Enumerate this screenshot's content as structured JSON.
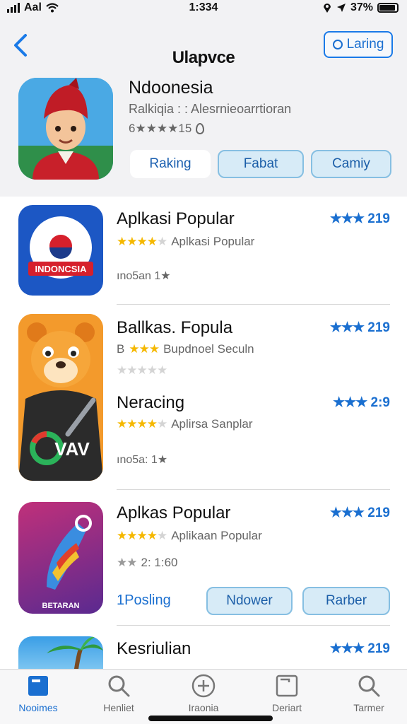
{
  "status": {
    "carrier": "Aal",
    "time": "1:334",
    "battery": "37%"
  },
  "header": {
    "brand": "Ulapvce",
    "lang_button": "Laring",
    "featured": {
      "title": "Ndoonesia",
      "subtitle": "Ralkiqia : : Alesrnieoarrtioran",
      "rating": "6★★★★15"
    },
    "pills": [
      "Raking",
      "Fabat",
      "Camiy"
    ]
  },
  "apps": [
    {
      "name": "Aplkasi Popular",
      "stars": 4,
      "subtitle": "Aplkasi Popular",
      "meta": "ıno5an 1★",
      "score": "219",
      "icon_text": "INDONCSIA"
    },
    {
      "name": "Ballkas. Fopula",
      "stars": 3,
      "subtitle_prefix": "B",
      "subtitle": "Bupdnoel Seculn",
      "score": "219"
    },
    {
      "name": "Neracing",
      "stars": 4,
      "subtitle": "Aplirsa Sanplar",
      "meta": "ıno5a: 1★",
      "score": "2:9",
      "icon_text": "VAV"
    },
    {
      "name": "Aplkas Popular",
      "stars": 4,
      "subtitle": "Aplikaan Popular",
      "meta": "2: 1:60",
      "score": "219",
      "icon_text": "BETARAN",
      "link": "1Posling",
      "buttons": [
        "Ndower",
        "Rarber"
      ]
    },
    {
      "name": "Kesriulian",
      "score": "219"
    }
  ],
  "tabs": [
    {
      "label": "Nooimes",
      "icon": "home-icon",
      "active": true
    },
    {
      "label": "Henliet",
      "icon": "search-icon",
      "active": false
    },
    {
      "label": "Iraonia",
      "icon": "plus-circle-icon",
      "active": false
    },
    {
      "label": "Deriart",
      "icon": "tablet-icon",
      "active": false
    },
    {
      "label": "Tarmer",
      "icon": "search-icon",
      "active": false
    }
  ],
  "colors": {
    "accent": "#1a6fd0",
    "star": "#f5b800",
    "header_bg": "#f2f2f4"
  }
}
